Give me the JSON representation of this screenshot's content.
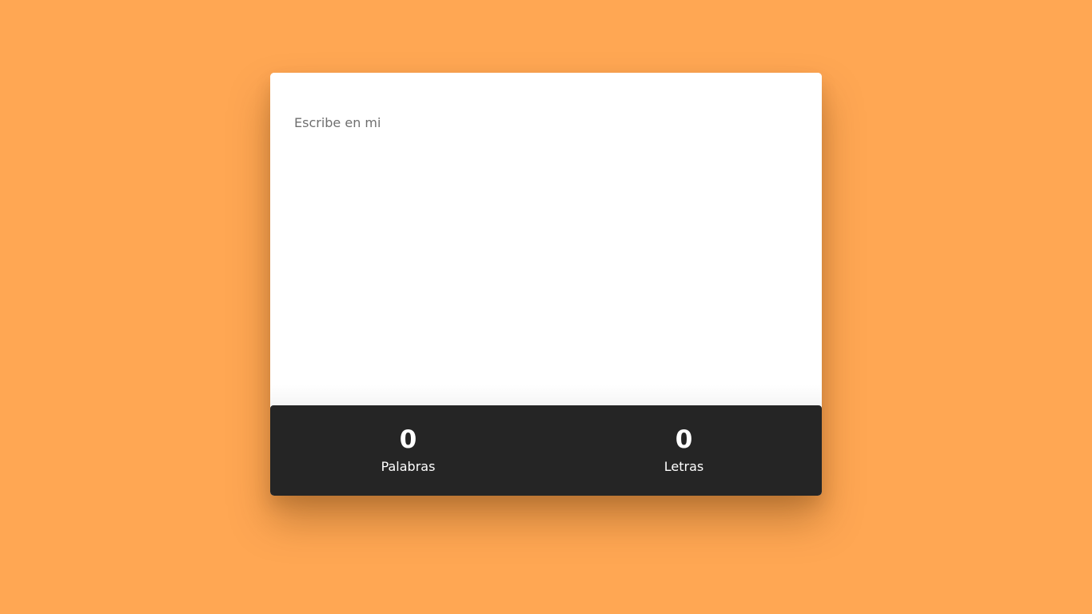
{
  "editor": {
    "placeholder": "Escribe en mi",
    "value": ""
  },
  "stats": [
    {
      "value": "0",
      "label": "Palabras"
    },
    {
      "value": "0",
      "label": "Letras"
    }
  ],
  "colors": {
    "background": "#FFA753",
    "card": "#FFFFFF",
    "stats_bar": "#252525",
    "text_light": "#FFFFFF",
    "placeholder": "#6F6F6F"
  }
}
